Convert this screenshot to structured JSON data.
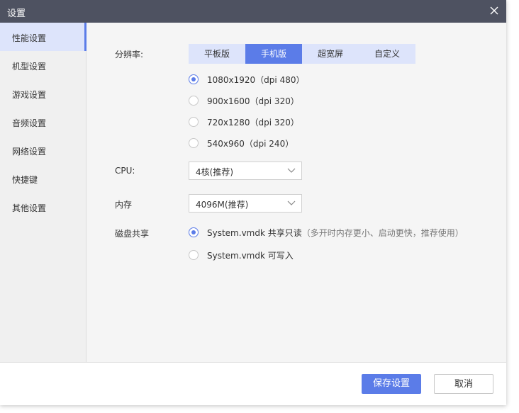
{
  "window": {
    "title": "设置",
    "close_icon": "close-icon"
  },
  "sidebar": {
    "items": [
      {
        "label": "性能设置",
        "active": true
      },
      {
        "label": "机型设置"
      },
      {
        "label": "游戏设置"
      },
      {
        "label": "音频设置"
      },
      {
        "label": "网络设置"
      },
      {
        "label": "快捷键"
      },
      {
        "label": "其他设置"
      }
    ]
  },
  "resolution": {
    "label": "分辨率:",
    "tabs": [
      "平板版",
      "手机版",
      "超宽屏",
      "自定义"
    ],
    "selected_tab": "手机版",
    "options": [
      "1080x1920（dpi 480）",
      "900x1600（dpi 320）",
      "720x1280（dpi 320）",
      "540x960（dpi 240）"
    ],
    "selected_option": "1080x1920（dpi 480）"
  },
  "cpu": {
    "label": "CPU:",
    "value": "4核(推荐)"
  },
  "memory": {
    "label": "内存",
    "value": "4096M(推荐)"
  },
  "disk": {
    "label": "磁盘共享",
    "options": [
      {
        "text": "System.vmdk 共享只读",
        "hint": "（多开时内存更小、启动更快，推荐使用）",
        "checked": true
      },
      {
        "text": "System.vmdk 可写入",
        "hint": "",
        "checked": false
      }
    ]
  },
  "footer": {
    "save_label": "保存设置",
    "cancel_label": "取消"
  },
  "colors": {
    "accent": "#5b7ce8",
    "titlebar": "#4e5261",
    "tab_bg": "#dde4fb"
  }
}
